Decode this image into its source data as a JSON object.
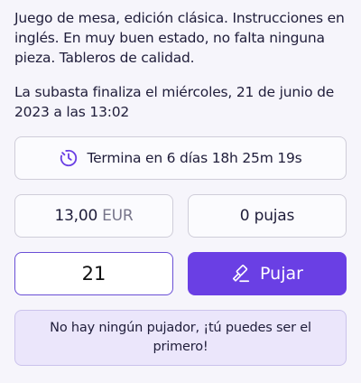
{
  "listing": {
    "description": "Juego de mesa, edición clásica. Instrucciones en inglés. En muy buen estado, no falta ninguna pieza. Tableros de calidad.",
    "auction_end_text": "La subasta finaliza el miércoles, 21 de junio de 2023 a las 13:02"
  },
  "countdown": {
    "icon": "timer-icon",
    "text": "Termina en 6 días 18h 25m 19s"
  },
  "price": {
    "amount": "13,00",
    "currency": "EUR"
  },
  "bids": {
    "count_label": "0 pujas"
  },
  "bid_form": {
    "input_value": "21",
    "button_label": "Pujar",
    "button_icon": "gavel-icon"
  },
  "notice": {
    "text": "No hay ningún pujador, ¡tú puedes ser el primero!"
  },
  "colors": {
    "accent": "#6a3fe4",
    "notice_bg": "#ebe6fb"
  }
}
